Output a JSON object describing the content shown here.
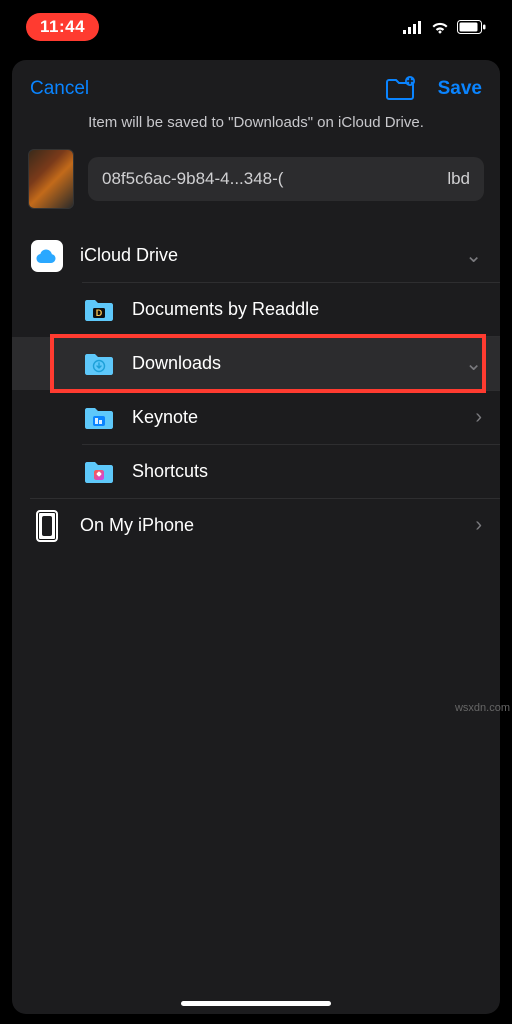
{
  "status": {
    "time": "11:44"
  },
  "nav": {
    "cancel": "Cancel",
    "save": "Save"
  },
  "subtitle": "Item will be saved to \"Downloads\" on iCloud Drive.",
  "file": {
    "name_prefix": "08f5c6ac-9b84-4...348-(",
    "name_suffix": "lbd"
  },
  "locations": {
    "icloud": {
      "label": "iCloud Drive"
    },
    "on_my_iphone": {
      "label": "On My iPhone"
    }
  },
  "folders": [
    {
      "label": "Documents by Readdle",
      "accessory": ""
    },
    {
      "label": "Downloads",
      "accessory": "v"
    },
    {
      "label": "Keynote",
      "accessory": ">"
    },
    {
      "label": "Shortcuts",
      "accessory": ""
    }
  ],
  "watermark": "wsxdn.com"
}
